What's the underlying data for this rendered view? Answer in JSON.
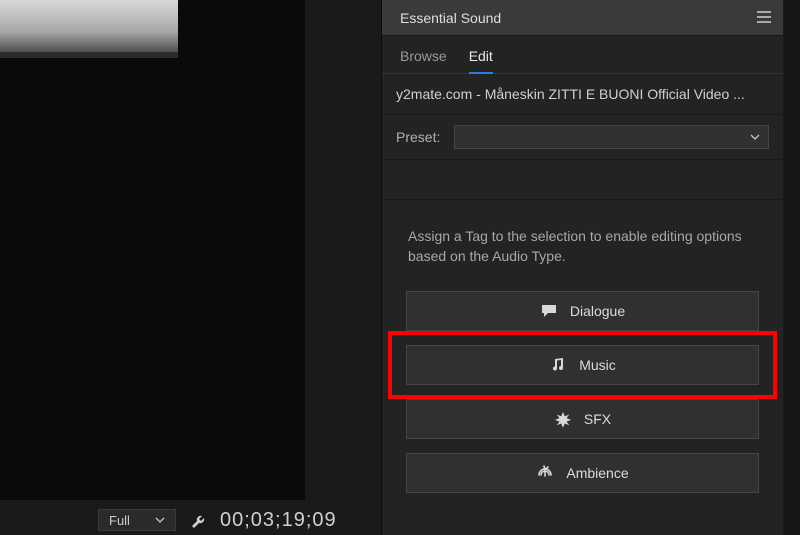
{
  "panel": {
    "title": "Essential Sound"
  },
  "tabs": {
    "browse": "Browse",
    "edit": "Edit"
  },
  "clip": {
    "name": "y2mate.com - Måneskin  ZITTI E BUONI Official Video  ..."
  },
  "preset": {
    "label": "Preset:",
    "value": ""
  },
  "instructions": {
    "text": "Assign a Tag to the selection to enable editing options based on the Audio Type."
  },
  "tags": {
    "dialogue": "Dialogue",
    "music": "Music",
    "sfx": "SFX",
    "ambience": "Ambience"
  },
  "monitor": {
    "resolution": "Full",
    "timecode": "00;03;19;09"
  }
}
